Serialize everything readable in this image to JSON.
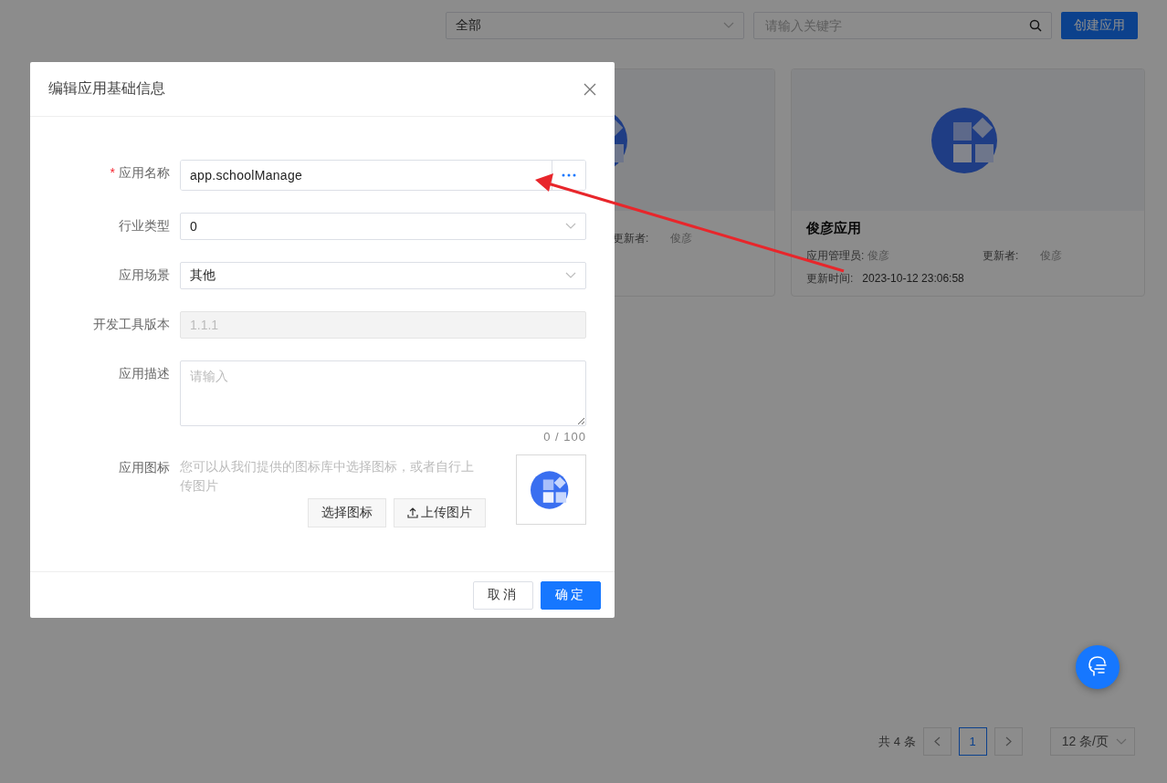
{
  "toolbar": {
    "filter": {
      "value": "全部"
    },
    "search": {
      "placeholder": "请输入关键字"
    },
    "create_button": "创建应用"
  },
  "cards": [
    {
      "updater_label": "更新者:",
      "updater": "俊彦"
    },
    {
      "title": "俊彦应用",
      "admin_label": "应用管理员:",
      "admin": "俊彦",
      "updater_label": "更新者:",
      "updater": "俊彦",
      "time_label": "更新时间:",
      "time": "2023-10-12 23:06:58"
    }
  ],
  "pagination": {
    "total": "共 4 条",
    "pages": [
      {
        "label": "1",
        "selected": true
      }
    ],
    "page_size": "12 条/页"
  },
  "dialog": {
    "title": "编辑应用基础信息",
    "fields": [
      {
        "kind": "input",
        "label": "应用名称",
        "required_mark": "*",
        "value": "app.schoolManage"
      },
      {
        "kind": "select",
        "label": "行业类型",
        "value": "0"
      },
      {
        "kind": "select",
        "label": "应用场景",
        "value": "其他"
      },
      {
        "kind": "disabled",
        "label": "开发工具版本",
        "value": "1.1.1"
      },
      {
        "kind": "textarea",
        "label": "应用描述",
        "placeholder": "请输入",
        "counter": "0 / 100"
      },
      {
        "kind": "icon",
        "label": "应用图标",
        "hint": "您可以从我们提供的图标库中选择图标，或者自行上传图片",
        "buttons": [
          "选择图标",
          "上传图片"
        ]
      }
    ],
    "buttons": [
      {
        "label": "取消",
        "primary": false
      },
      {
        "label": "确定",
        "primary": true
      }
    ]
  }
}
